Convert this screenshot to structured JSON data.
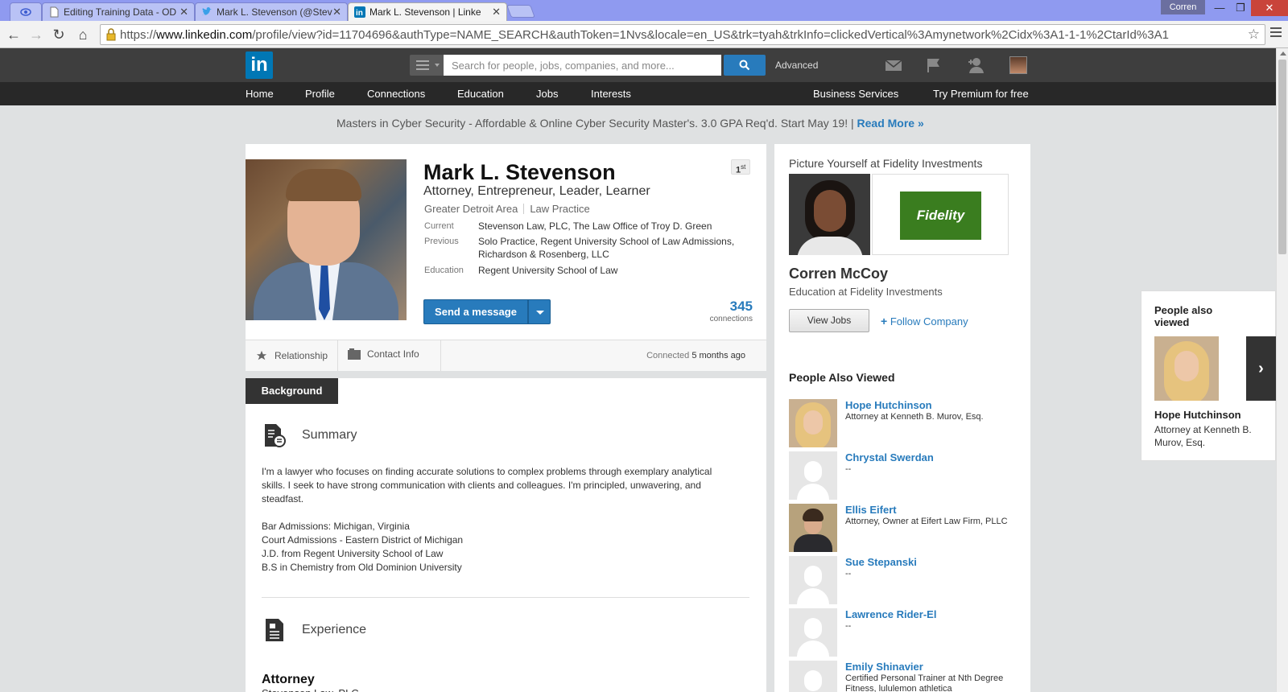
{
  "browser": {
    "tabs": [
      {
        "title": "Editing Training Data - OD"
      },
      {
        "title": "Mark L. Stevenson (@Stev"
      },
      {
        "title": "Mark L. Stevenson | Linke"
      }
    ],
    "user": "Corren",
    "url_prefix": "https://",
    "url_host": "www.linkedin.com",
    "url_path": "/profile/view?id=11704696&authType=NAME_SEARCH&authToken=1Nvs&locale=en_US&trk=tyah&trkInfo=clickedVertical%3Amynetwork%2Cidx%3A1-1-1%2CtarId%3A1"
  },
  "header": {
    "logo": "in",
    "search_placeholder": "Search for people, jobs, companies, and more...",
    "advanced": "Advanced"
  },
  "nav": {
    "items": [
      "Home",
      "Profile",
      "Connections",
      "Education",
      "Jobs",
      "Interests"
    ],
    "right": [
      "Business Services",
      "Try Premium for free"
    ]
  },
  "banner": {
    "text": "Masters in Cyber Security - Affordable & Online Cyber Security Master's. 3.0 GPA Req'd. Start May 19! |",
    "link": "Read More »"
  },
  "profile": {
    "name": "Mark L. Stevenson",
    "headline": "Attorney, Entrepreneur, Leader, Learner",
    "location": "Greater Detroit Area",
    "industry": "Law Practice",
    "degree": "1",
    "degree_suffix": "st",
    "current_label": "Current",
    "current": "Stevenson Law, PLC, The Law Office of Troy D. Green",
    "previous_label": "Previous",
    "previous": "Solo Practice, Regent University School of Law Admissions, Richardson & Rosenberg, LLC",
    "education_label": "Education",
    "education": "Regent University School of Law",
    "send_message": "Send a message",
    "connections": "345",
    "connections_label": "connections",
    "relationship": "Relationship",
    "contact_info": "Contact Info",
    "connected_prefix": "Connected",
    "connected_time": "5 months ago"
  },
  "background": {
    "tab": "Background",
    "summary_title": "Summary",
    "summary_p1": "I'm a lawyer who focuses on finding accurate solutions to complex problems through exemplary analytical skills. I seek to have strong communication with clients and colleagues. I'm principled, unwavering, and steadfast.",
    "admissions": [
      "Bar Admissions: Michigan, Virginia",
      "Court Admissions - Eastern District of Michigan",
      "J.D. from Regent University School of Law",
      "B.S in Chemistry from Old Dominion University"
    ],
    "experience_title": "Experience",
    "exp_position": "Attorney",
    "exp_company": "Stevenson Law, PLC"
  },
  "ad": {
    "title": "Picture Yourself at Fidelity Investments",
    "logo": "Fidelity",
    "name": "Corren McCoy",
    "subtitle": "Education at Fidelity Investments",
    "view_jobs": "View Jobs",
    "follow": "Follow Company"
  },
  "people_also_viewed": {
    "title": "People Also Viewed",
    "people": [
      {
        "name": "Hope Hutchinson",
        "title": "Attorney at Kenneth B. Murov, Esq."
      },
      {
        "name": "Chrystal Swerdan",
        "title": "--"
      },
      {
        "name": "Ellis Eifert",
        "title": "Attorney, Owner at Eifert Law Firm, PLLC"
      },
      {
        "name": "Sue Stepanski",
        "title": "--"
      },
      {
        "name": "Lawrence Rider-El",
        "title": "--"
      },
      {
        "name": "Emily Shinavier",
        "title": "Certified Personal Trainer at Nth Degree Fitness, lululemon athletica"
      }
    ]
  },
  "floating": {
    "title": "People also viewed",
    "name": "Hope Hutchinson",
    "subtitle": "Attorney at Kenneth B. Murov, Esq."
  }
}
